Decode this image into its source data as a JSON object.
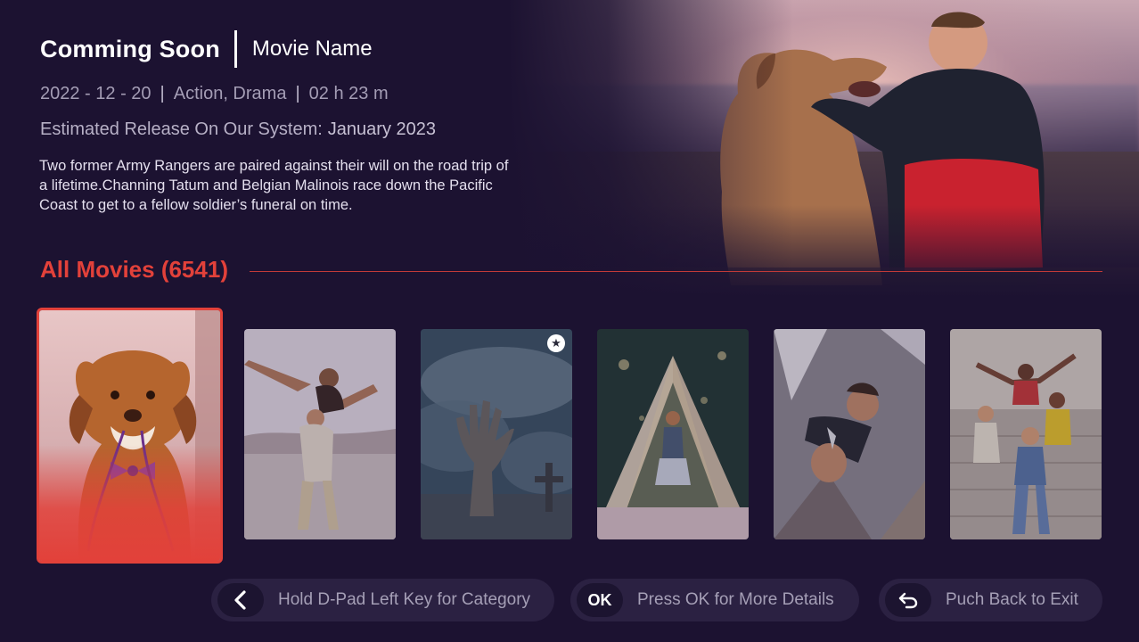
{
  "header": {
    "status": "Comming Soon",
    "movie_name": "Movie Name"
  },
  "meta": {
    "date": "2022 - 12 - 20",
    "separator_1": "|",
    "genres": "Action, Drama",
    "separator_2": "|",
    "duration": "02 h 23 m"
  },
  "release": {
    "label": "Estimated Release On Our System:",
    "value": "January 2023"
  },
  "description": "Two former Army Rangers are paired against their will on the road trip of a lifetime.Channing Tatum and Belgian Malinois race down the Pacific Coast to get to a fellow soldier’s funeral on time.",
  "section": {
    "title": "All Movies (6541)"
  },
  "movies": [
    {
      "art": "dog-with-bowtie",
      "selected": true
    },
    {
      "art": "couple-piggyback-beach",
      "selected": false
    },
    {
      "art": "zombie-hand-storm",
      "selected": false,
      "favorite": true
    },
    {
      "art": "girl-giant-book",
      "selected": false
    },
    {
      "art": "flying-superhero-man",
      "selected": false
    },
    {
      "art": "friends-on-stairs",
      "selected": false
    }
  ],
  "hints": [
    {
      "icon": "chevron-left-icon",
      "label": "Hold D-Pad Left Key for Category"
    },
    {
      "key": "OK",
      "label": "Press OK for More Details"
    },
    {
      "icon": "back-arrow-icon",
      "label": "Puch Back to Exit"
    }
  ],
  "colors": {
    "background": "#1c1231",
    "accent": "#e2413a",
    "pill": "#2b2142"
  }
}
